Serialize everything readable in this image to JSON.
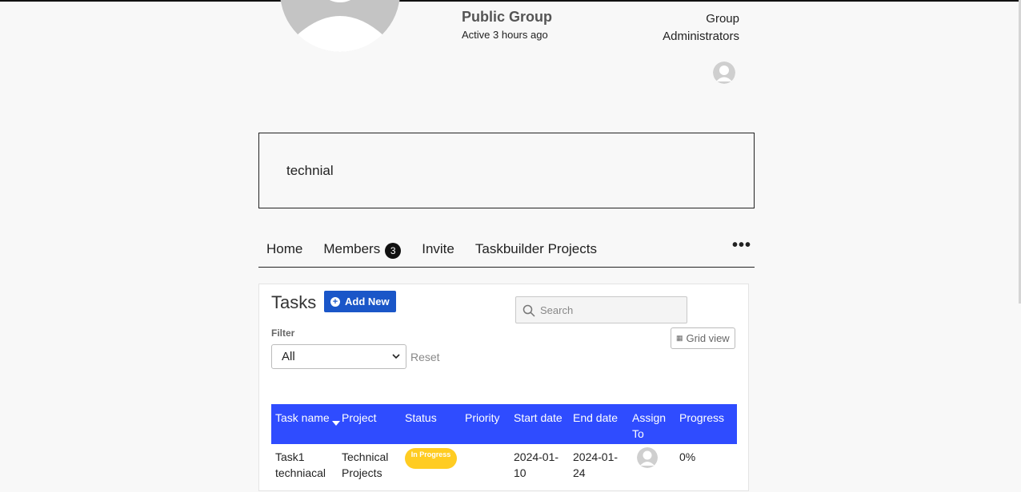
{
  "group": {
    "type": "Public Group",
    "active": "Active 3 hours ago",
    "admins_label": "Group Administrators",
    "description": "technial"
  },
  "nav": {
    "tabs": [
      {
        "label": "Home"
      },
      {
        "label": "Members",
        "badge": "3"
      },
      {
        "label": "Invite"
      },
      {
        "label": "Taskbuilder Projects"
      }
    ],
    "more": "•••"
  },
  "tasks": {
    "title": "Tasks",
    "add_new": "Add New",
    "search_placeholder": "Search",
    "grid_view": "Grid view",
    "filter_label": "Filter",
    "filter_value": "All",
    "reset": "Reset",
    "columns": [
      "Task name",
      "Project",
      "Status",
      "Priority",
      "Start date",
      "End date",
      "Assign To",
      "Progress"
    ],
    "rows": [
      {
        "task_name": "Task1 techniacal",
        "project": "Technical Projects",
        "status": "In Progress",
        "priority": "",
        "start_date": "2024-01-10",
        "end_date": "2024-01-24",
        "progress": "0%"
      }
    ]
  },
  "colors": {
    "accent_blue": "#1a56c8",
    "table_header": "#2f4cff",
    "status_in_progress": "#ffcc22"
  }
}
